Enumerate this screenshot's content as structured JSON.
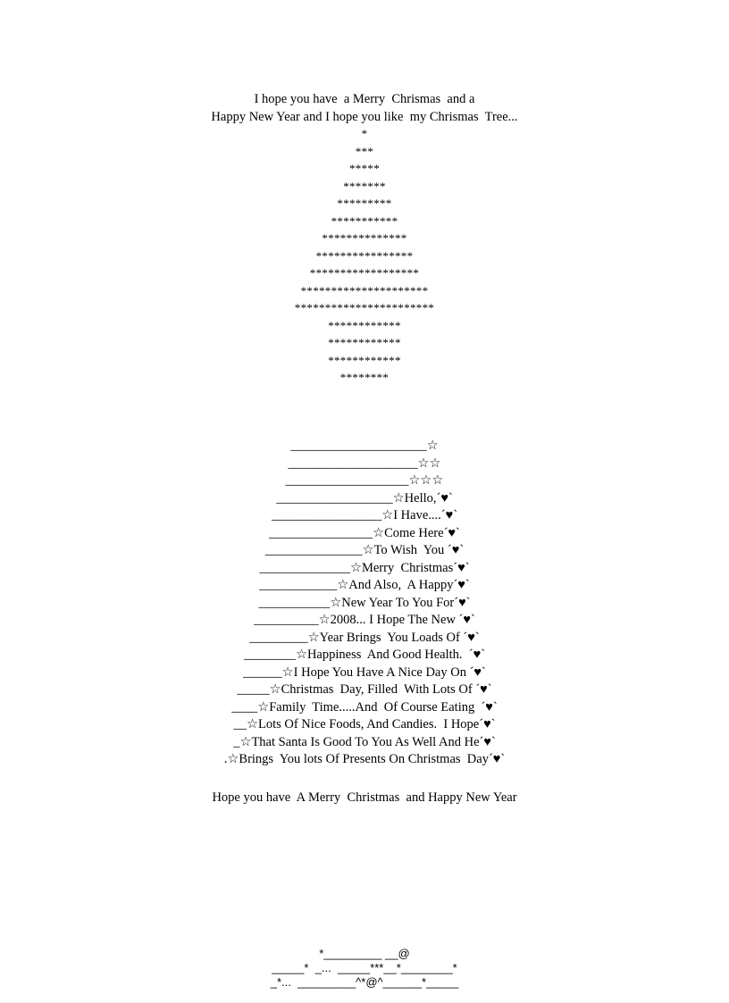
{
  "intro": [
    "I hope you have  a Merry  Chrismas  and a",
    "Happy New Year and I hope you like  my Chrismas  Tree..."
  ],
  "tree": [
    "*",
    "***",
    "*****",
    "*******",
    "*********",
    "***********",
    "**************",
    "****************",
    "******************",
    "*********************",
    "***********************",
    "************",
    "************",
    "************",
    "********"
  ],
  "star_tree": [
    "_____________________☆",
    "____________________☆☆",
    "___________________☆☆☆",
    "__________________☆Hello,´♥`",
    "_________________☆I Have....´♥`",
    "________________☆Come Here´♥`",
    "_______________☆To Wish  You ´♥`",
    "______________☆Merry  Christmas´♥`",
    "____________☆And Also,  A Happy´♥`",
    "___________☆New Year To You For´♥`",
    "__________☆2008... I Hope The New ´♥`",
    "_________☆Year Brings  You Loads Of ´♥`",
    "________☆Happiness  And Good Health.  ´♥`",
    "______☆I Hope You Have A Nice Day On ´♥`",
    "_____☆Christmas  Day, Filled  With Lots Of ´♥`",
    "____☆Family  Time.....And  Of Course Eating  ´♥`",
    "__☆Lots Of Nice Foods, And Candies.  I Hope´♥`",
    "_☆That Santa Is Good To You As Well And He´♥`",
    ".☆Brings  You lots Of Presents On Christmas  Day´♥`"
  ],
  "closing": "Hope you have  A Merry  Christmas  and Happy New Year",
  "footer_art": [
    "*_________ __@",
    "_____*  _...  _____***__*________*",
    "_*...  _________^*@^______*_____"
  ]
}
